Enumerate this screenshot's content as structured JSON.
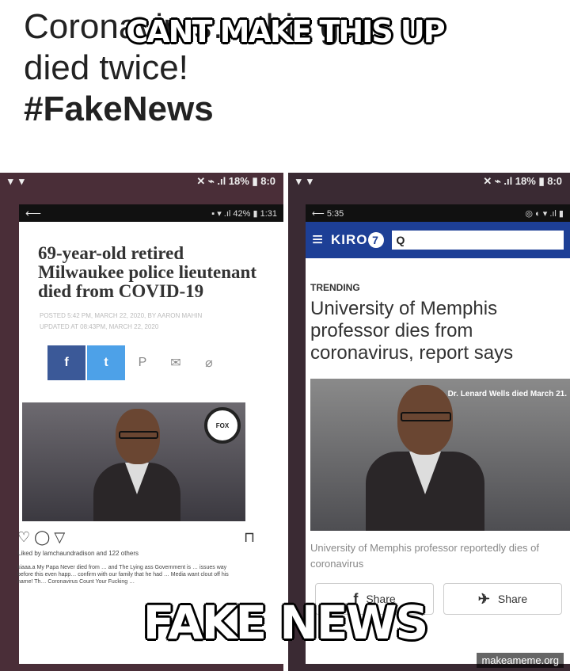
{
  "meme": {
    "top_text": "CANT MAKE THIS UP",
    "bottom_text": "FAKE NEWS",
    "watermark": "makeameme.org"
  },
  "post": {
    "line1": "Coronavirus… this guy",
    "line2": "died twice!",
    "line3": "#FakeNews"
  },
  "left_phone": {
    "status": {
      "left": "▾ ▾",
      "right": "✕ ⌁ .ıl 18% ▮ 8:0"
    },
    "inner_status": {
      "left": "⟵",
      "right": "▪ ▾ .ıl 42% ▮ 1:31"
    },
    "headline": "69-year-old retired Milwaukee police lieutenant died from COVID-19",
    "byline1": "POSTED 5:42 PM, MARCH 22, 2020, BY AARON MAHIN",
    "byline2": "UPDATED AT 08:43PM, MARCH 22, 2020",
    "share": {
      "facebook": "f",
      "twitter": "t",
      "pinterest": "P",
      "email": "✉",
      "link": "⌀"
    },
    "badge": "FOX",
    "likes": "Liked by lamchaundradison and 122 others",
    "comment": "kiaaa.a My Papa Never died from … and The Lying ass Government is … issues way before this even happ… confirm with our family that he had … Media want clout off his name! Th… Coronavirus Count Your Fucking …"
  },
  "right_phone": {
    "status": {
      "left": "▾ ▾",
      "right": "✕ ⌁ .ıl 18% ▮ 8:0"
    },
    "inner_status": {
      "left": "⟵ 5:35",
      "right": "◎ ◐ ▾ .ıl ▮"
    },
    "brand": "KIRO",
    "brand_number": "7",
    "search_label": "Q",
    "trending": "TRENDING",
    "headline": "University of Memphis professor dies from coronavirus, report says",
    "photo_caption_overlay": "Dr. Lenard Wells died March 21.",
    "photo_caption": "University of Memphis professor reportedly dies of coronavirus",
    "share_left": "Share",
    "share_right": "Share"
  }
}
